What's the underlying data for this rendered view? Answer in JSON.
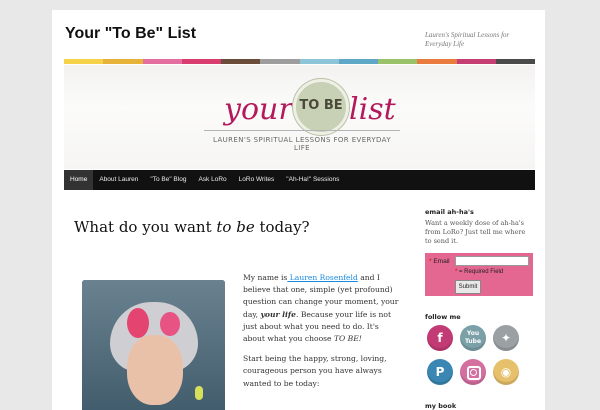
{
  "header": {
    "site_title": "Your \"To Be\" List",
    "tagline": "Lauren's Spiritual Lessons for Everyday Life"
  },
  "banner": {
    "word_your": "your",
    "badge": "TO BE",
    "word_list": "list",
    "subtitle": "LAUREN'S SPIRITUAL LESSONS FOR EVERYDAY LIFE",
    "stripe_colors": [
      "#f5d24a",
      "#e7b23a",
      "#e46ea0",
      "#d93c6f",
      "#6b4b3a",
      "#9d9d9d",
      "#8cc4d8",
      "#5fa7c7",
      "#9ac26b",
      "#e97b3f",
      "#c43e73",
      "#4a4a4a"
    ]
  },
  "nav": {
    "items": [
      "Home",
      "About Lauren",
      "\"To Be\" Blog",
      "Ask LoRo",
      "LoRo Writes",
      "\"Ah-Ha!\" Sessions"
    ]
  },
  "post": {
    "title_pre": "What do you want ",
    "title_em": "to be",
    "title_post": " today?",
    "p1_a": "My name is",
    "p1_link": " Lauren Rosenfeld",
    "p1_b": "  and I believe that one, simple (yet profound) question can change your moment, your day, ",
    "p1_bold": "your life",
    "p1_c": ". Because your life is not just about what you need to do. It's about what you choose ",
    "p1_em": "TO BE!",
    "p2": "Start being the happy, strong, loving, courageous person you have always wanted to be today:"
  },
  "sidebar": {
    "email_title": "email ah-ha's",
    "email_desc": "Want a weekly dose of ah-ha's from LoRo? Just tell me where to send it.",
    "email_label": "Email",
    "required_star": "*",
    "required_text": " = Required Field",
    "submit_label": "Submit",
    "follow_title": "follow me",
    "social": {
      "facebook": "f",
      "youtube": "You\nTube",
      "twitter": "✦",
      "pinterest": "P",
      "rss": "◉"
    },
    "book_title": "my book"
  },
  "colors": {
    "brand_pink": "#b3195b",
    "form_pink": "#e46792",
    "link_blue": "#1b8be0",
    "nav_bg": "#111111"
  }
}
